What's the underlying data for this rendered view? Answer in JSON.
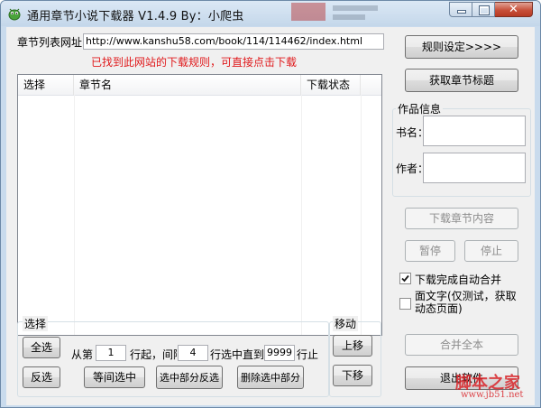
{
  "window": {
    "title": "通用章节小说下载器 V1.4.9 By：小爬虫",
    "controls": [
      "minimize",
      "maximize",
      "close"
    ],
    "close_glyph": "✕"
  },
  "url_row": {
    "label": "章节列表网址",
    "value": "http://www.kanshu58.com/book/114/114462/index.html",
    "notice": "已找到此网站的下载规则，可直接点击下载",
    "notice_color": "#e0191b"
  },
  "chapter_list": {
    "columns": [
      "选择",
      "章节名",
      "下载状态"
    ],
    "rows": []
  },
  "select_group": {
    "title": "选择",
    "select_all": "全选",
    "invert": "反选",
    "from_label": "从第",
    "from_value": "1",
    "start_label": "行起，间隔",
    "interval_value": "4",
    "until_label": "行选中直到",
    "until_value": "9999",
    "end_label": "行止",
    "interval_select_btn": "等间选中",
    "partial_invert_btn": "选中部分反选",
    "delete_selected_btn": "删除选中部分"
  },
  "move_group": {
    "title": "移动",
    "up": "上移",
    "down": "下移"
  },
  "right_panel": {
    "rules_btn": "规则设定>>>>",
    "get_titles_btn": "获取章节标题",
    "info_title": "作品信息",
    "book_name_label": "书名：",
    "book_name_value": "",
    "author_label": "作者：",
    "author_value": "",
    "download_btn": "下载章节内容",
    "pause_btn": "暂停",
    "stop_btn": "停止",
    "auto_merge_label": "下载完成自动合并",
    "auto_merge_checked": true,
    "dynamic_label": "面文字(仅测试，获取动态页面)",
    "dynamic_checked": false,
    "merge_all_btn": "合并全本",
    "exit_btn": "退出软件"
  },
  "watermark": {
    "text": "脚本之家",
    "url": "www.jb51.net",
    "color": "#d9262b"
  }
}
